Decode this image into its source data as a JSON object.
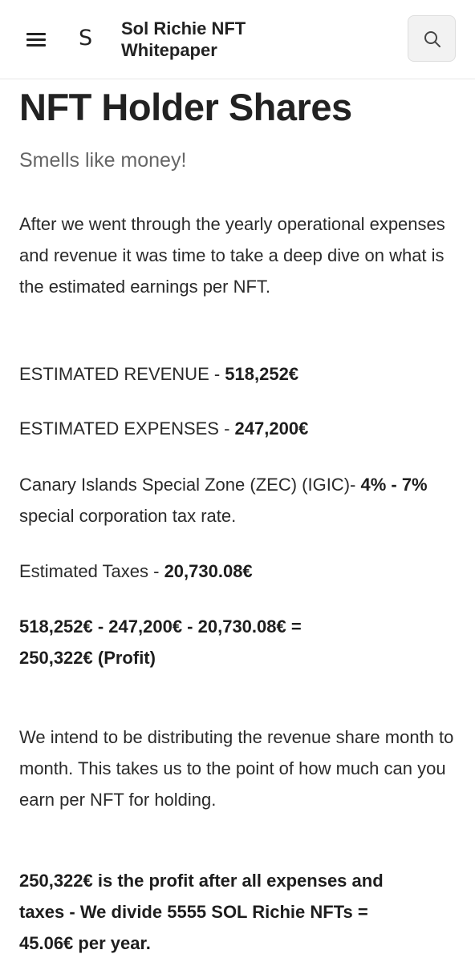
{
  "header": {
    "logo_letter": "S",
    "site_title_line1": "Sol Richie NFT",
    "site_title_line2": "Whitepaper"
  },
  "icons": {
    "menu": "hamburger-menu-icon",
    "search": "search-icon"
  },
  "colors": {
    "text": "#222222",
    "subtitle": "#666666",
    "search_bg": "#f2f2f2"
  },
  "page": {
    "title": "NFT Holder Shares",
    "subtitle": "Smells like money!",
    "intro": "After we went through the yearly operational expenses and revenue it was time to take a deep dive on what is the estimated earnings per NFT.",
    "revenue_label": "ESTIMATED REVENUE - ",
    "revenue_value": "518,252€",
    "expenses_label": "ESTIMATED EXPENSES - ",
    "expenses_value": "247,200€",
    "zec_label": "Canary Islands Special Zone (ZEC) (IGIC)- ",
    "zec_value": "4% - 7%",
    "zec_suffix": " special corporation tax rate.",
    "taxes_label": "Estimated Taxes - ",
    "taxes_value": "20,730.08€",
    "equation_line1": "518,252€ - 247,200€ - 20,730.08€ =",
    "equation_line2": "250,322€ (Profit)",
    "distribution": "We intend to be distributing the revenue share month to month. This takes us to the point of how much can you earn per NFT for holding.",
    "summary_line1": "250,322€ is the profit after all expenses and",
    "summary_line2": "taxes - We divide 5555 SOL Richie NFTs =",
    "summary_line3": "45.06€ per year."
  }
}
